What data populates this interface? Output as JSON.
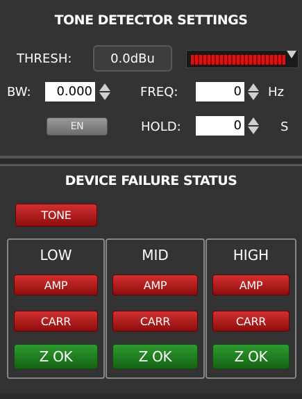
{
  "tone_detector": {
    "title": "TONE DETECTOR SETTINGS",
    "thresh_label": "THRESH:",
    "thresh_value": "0.0dBu",
    "meter_level": 0.92,
    "bw_label": "BW:",
    "bw_value": "0.000",
    "freq_label": "FREQ:",
    "freq_value": "0",
    "freq_unit": "Hz",
    "en_label": "EN",
    "hold_label": "HOLD:",
    "hold_value": "0",
    "hold_unit": "S"
  },
  "failure": {
    "title": "DEVICE FAILURE STATUS",
    "tone_label": "TONE",
    "bands": [
      {
        "label": "LOW",
        "amp": "AMP",
        "carr": "CARR",
        "z": "Z OK"
      },
      {
        "label": "MID",
        "amp": "AMP",
        "carr": "CARR",
        "z": "Z OK"
      },
      {
        "label": "HIGH",
        "amp": "AMP",
        "carr": "CARR",
        "z": "Z OK"
      }
    ]
  },
  "colors": {
    "background": "#333333",
    "fault_red": "#b01818",
    "ok_green": "#1f7f1f",
    "meter_red": "#e01010"
  }
}
